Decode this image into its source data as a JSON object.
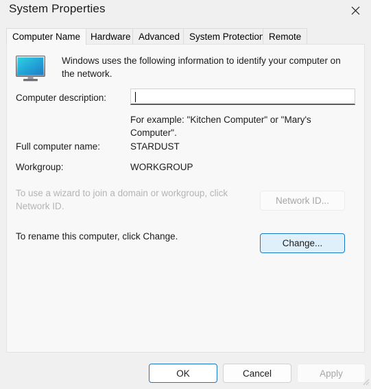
{
  "window": {
    "title": "System Properties",
    "close_icon": "close-icon"
  },
  "tabs": [
    {
      "label": "Computer Name",
      "selected": true
    },
    {
      "label": "Hardware",
      "selected": false
    },
    {
      "label": "Advanced",
      "selected": false
    },
    {
      "label": "System Protection",
      "selected": false
    },
    {
      "label": "Remote",
      "selected": false
    }
  ],
  "content": {
    "monitor_icon": "computer-monitor-icon",
    "intro_text": "Windows uses the following information to identify your computer on the network.",
    "description_label": "Computer description:",
    "description_value": "",
    "description_placeholder": "",
    "example_text": "For example: \"Kitchen Computer\" or \"Mary's Computer\".",
    "full_name_label": "Full computer name:",
    "full_name_value": "STARDUST",
    "workgroup_label": "Workgroup:",
    "workgroup_value": "WORKGROUP",
    "network_id_text": "To use a wizard to join a domain or workgroup, click Network ID.",
    "network_id_button": "Network ID...",
    "rename_text": "To rename this computer, click Change.",
    "change_button": "Change..."
  },
  "footer": {
    "ok_label": "OK",
    "cancel_label": "Cancel",
    "apply_label": "Apply"
  },
  "colors": {
    "accent_blue": "#1878c8",
    "accent_fill": "#dff0fb",
    "dialog_bg": "#f0f0f0",
    "panel_bg": "#f8f8f8",
    "disabled_text": "#b4b4b4",
    "text": "#1b1b1b"
  }
}
